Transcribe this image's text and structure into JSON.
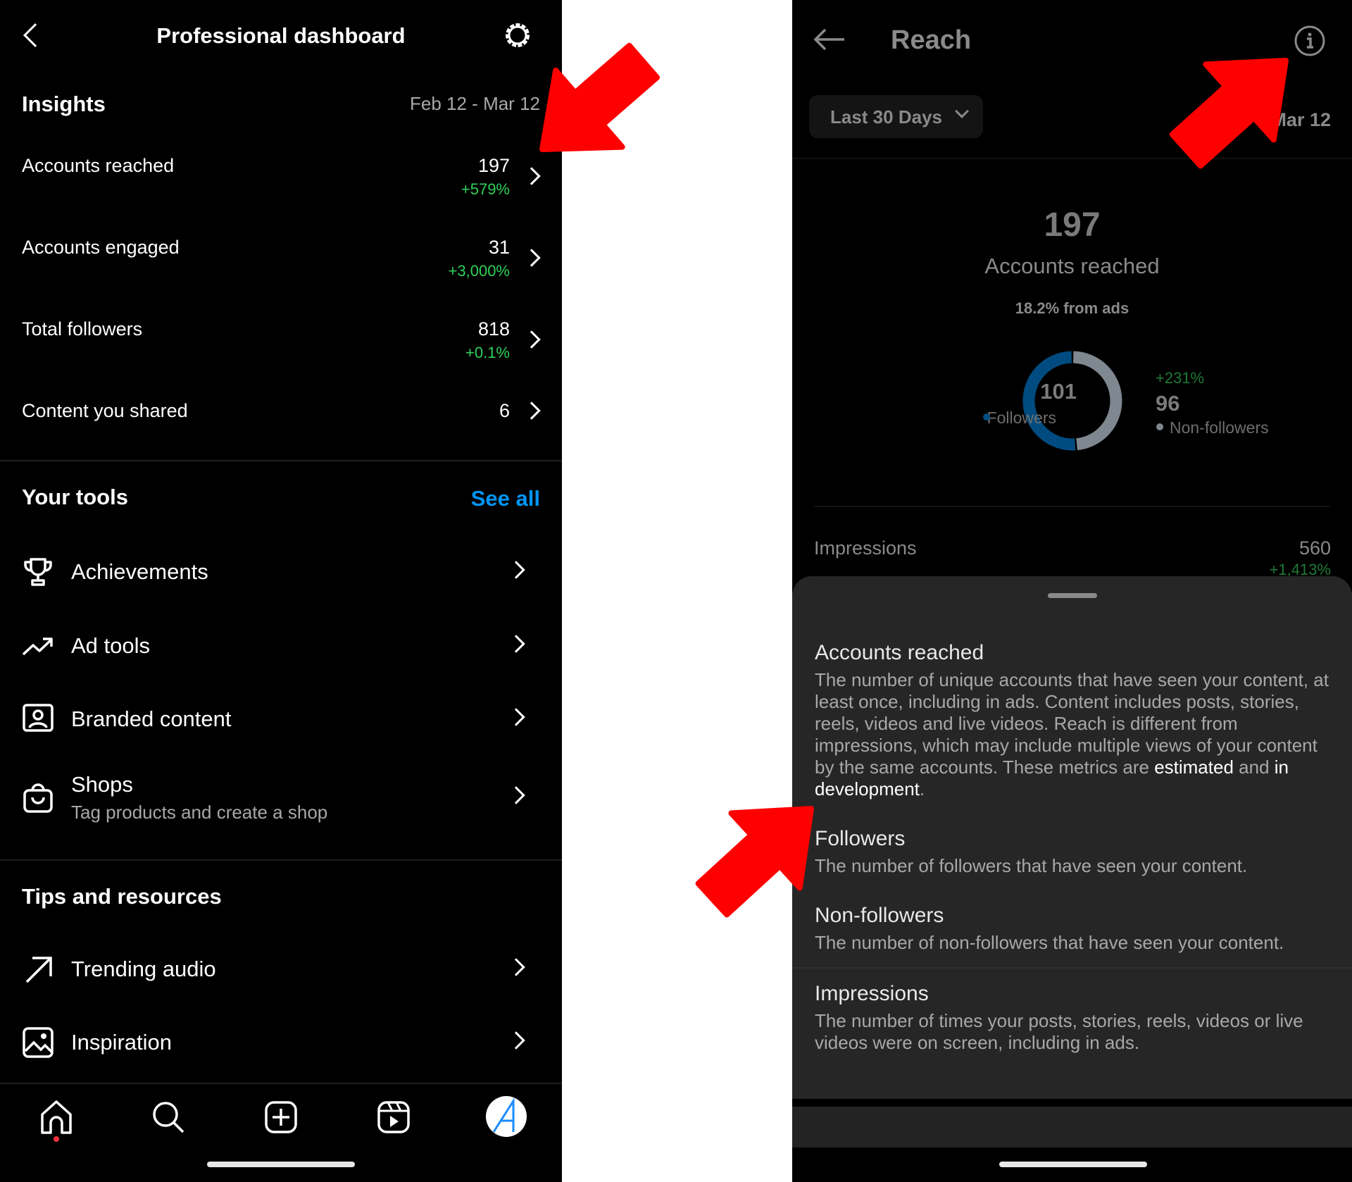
{
  "left": {
    "header": {
      "title": "Professional dashboard",
      "back_icon": "chevron-left-icon",
      "settings_icon": "gear-icon"
    },
    "insights": {
      "title": "Insights",
      "date_range": "Feb 12 - Mar 12",
      "rows": [
        {
          "label": "Accounts reached",
          "value": "197",
          "change": "+579%"
        },
        {
          "label": "Accounts engaged",
          "value": "31",
          "change": "+3,000%"
        },
        {
          "label": "Total followers",
          "value": "818",
          "change": "+0.1%"
        },
        {
          "label": "Content you shared",
          "value": "6"
        }
      ]
    },
    "tools": {
      "title": "Your tools",
      "see_all": "See all",
      "items": [
        {
          "label": "Achievements",
          "icon": "trophy-icon"
        },
        {
          "label": "Ad tools",
          "icon": "trending-up-icon"
        },
        {
          "label": "Branded content",
          "icon": "branded-content-icon"
        },
        {
          "label": "Shops",
          "sublabel": "Tag products and create a shop",
          "icon": "shopping-bag-icon"
        }
      ]
    },
    "tips": {
      "title": "Tips and resources",
      "items": [
        {
          "label": "Trending audio",
          "icon": "arrow-up-right-icon"
        },
        {
          "label": "Inspiration",
          "icon": "image-icon"
        }
      ]
    },
    "nav": [
      "home-icon",
      "search-icon",
      "create-icon",
      "reels-icon",
      "profile-avatar"
    ],
    "accent": "#0095f6"
  },
  "right": {
    "header": {
      "title": "Reach",
      "back_icon": "arrow-left-icon",
      "info_icon": "info-icon"
    },
    "dropdown": {
      "value": "Last 30 Days"
    },
    "date_range": "Mar 12",
    "summary": {
      "value": "197",
      "label": "Accounts reached",
      "ads": "18.2% from ads"
    },
    "donut": {
      "followers": {
        "value": "101",
        "label": "Followers",
        "color": "#004c81"
      },
      "non_followers": {
        "value": "96",
        "label": "Non-followers",
        "change": "+231%",
        "color": "#7f8790"
      }
    },
    "impressions": {
      "label": "Impressions",
      "value": "560",
      "change": "+1,413%"
    },
    "sheet": [
      {
        "title": "Accounts reached",
        "body": [
          "The number of unique accounts that have seen your content, at least once, including in ads. Content includes posts, stories, reels, videos and live videos. Reach is different from impressions, which may include multiple views of your content by the same accounts. These metrics are ",
          "estimated",
          " and ",
          "in development",
          "."
        ]
      },
      {
        "title": "Followers",
        "body": [
          "The number of followers that have seen your content."
        ]
      },
      {
        "title": "Non-followers",
        "body": [
          "The number of non-followers that have seen your content."
        ]
      },
      {
        "title": "Impressions",
        "body": [
          "The number of times your posts, stories, reels, videos or live videos were on screen, including in ads."
        ]
      }
    ]
  },
  "annotation_color": "#ff0000"
}
